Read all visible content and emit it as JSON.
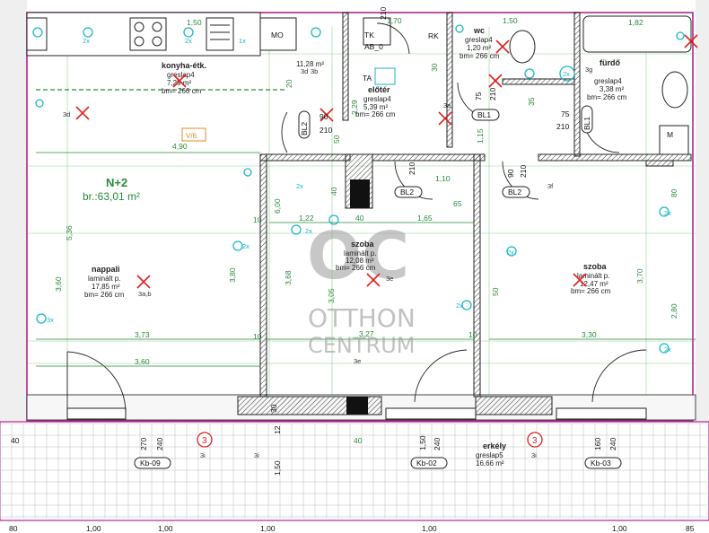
{
  "watermark": {
    "line1": "OTTHON",
    "line2": "CENTRUM"
  },
  "apartment": {
    "id": "N+2",
    "area": "br.:63,01 m²"
  },
  "rooms": [
    {
      "key": "konyha",
      "name": "konyha-étk.",
      "floor": "greslap4",
      "area": "7,29 m²",
      "height": "bm= 266 cm"
    },
    {
      "key": "wc",
      "name": "wc",
      "floor": "greslap4",
      "area": "1,20 m²",
      "height": "bm= 266 cm"
    },
    {
      "key": "furdo",
      "name": "fürdő",
      "floor": "greslap4",
      "area": "3,38 m²",
      "height": "bm= 266 cm"
    },
    {
      "key": "eloter",
      "name": "előtér",
      "floor": "greslap4",
      "area": "5,39 m²",
      "height": "bm= 266 cm"
    },
    {
      "key": "nappali",
      "name": "nappali",
      "floor": "laminált p.",
      "area": "17,85 m²",
      "height": "bm= 266 cm"
    },
    {
      "key": "szoba1",
      "name": "szoba",
      "floor": "laminált p.",
      "area": "12,08 m²",
      "height": "bm= 266 cm"
    },
    {
      "key": "szoba2",
      "name": "szoba",
      "floor": "laminált p.",
      "area": "12,47 m²",
      "height": "bm= 266 cm"
    },
    {
      "key": "erkely",
      "name": "erkély",
      "floor": "greslap5",
      "area": "16,66 m²",
      "height": ""
    }
  ],
  "extra_area": "11,28 m²",
  "codes": {
    "v6": "V/6.",
    "bl1": "BL1",
    "bl2": "BL2",
    "tk": "TK",
    "rk": "RK",
    "ta": "TA",
    "ab": "AB_0",
    "mo": "MO",
    "m": "M",
    "kb09": "Kb-09",
    "kb02": "Kb-02",
    "kb03": "Kb-03",
    "three": "3",
    "i3": "3i"
  },
  "marks": {
    "m3d": "3d",
    "m3a": "3a",
    "m3b": "3b",
    "m3f": "3f",
    "m3g": "3g",
    "m3e": "3e",
    "m3ab": "3a,b",
    "m2x": "2x",
    "m3x": "3x",
    "m1x": "1x"
  },
  "dimensions": {
    "d490": "4,90",
    "d373": "3,73",
    "d360": "3,60",
    "d327": "3,27",
    "d330": "3,30",
    "d122": "1,22",
    "d165": "1,65",
    "d110": "1,10",
    "d65": "65",
    "d40": "40",
    "d10": "10",
    "d90": "90",
    "d75": "75",
    "d210": "210",
    "d170": "1,70",
    "d150": "1,50",
    "d182": "1,82",
    "d536": "5,36",
    "d600": "6,00",
    "d380": "3,80",
    "d368": "3,68",
    "d305": "3,05",
    "d370": "3,70",
    "d280": "2,80",
    "d80": "80",
    "d50": "50",
    "d229": "2,29",
    "d105": "1,05",
    "d270": "270",
    "d240": "240",
    "d160": "160",
    "d12": "12",
    "d100": "1,00",
    "d85": "85",
    "d20": "20",
    "d30": "30",
    "d35": "35",
    "d115": "1,15",
    "d30b": "30"
  }
}
